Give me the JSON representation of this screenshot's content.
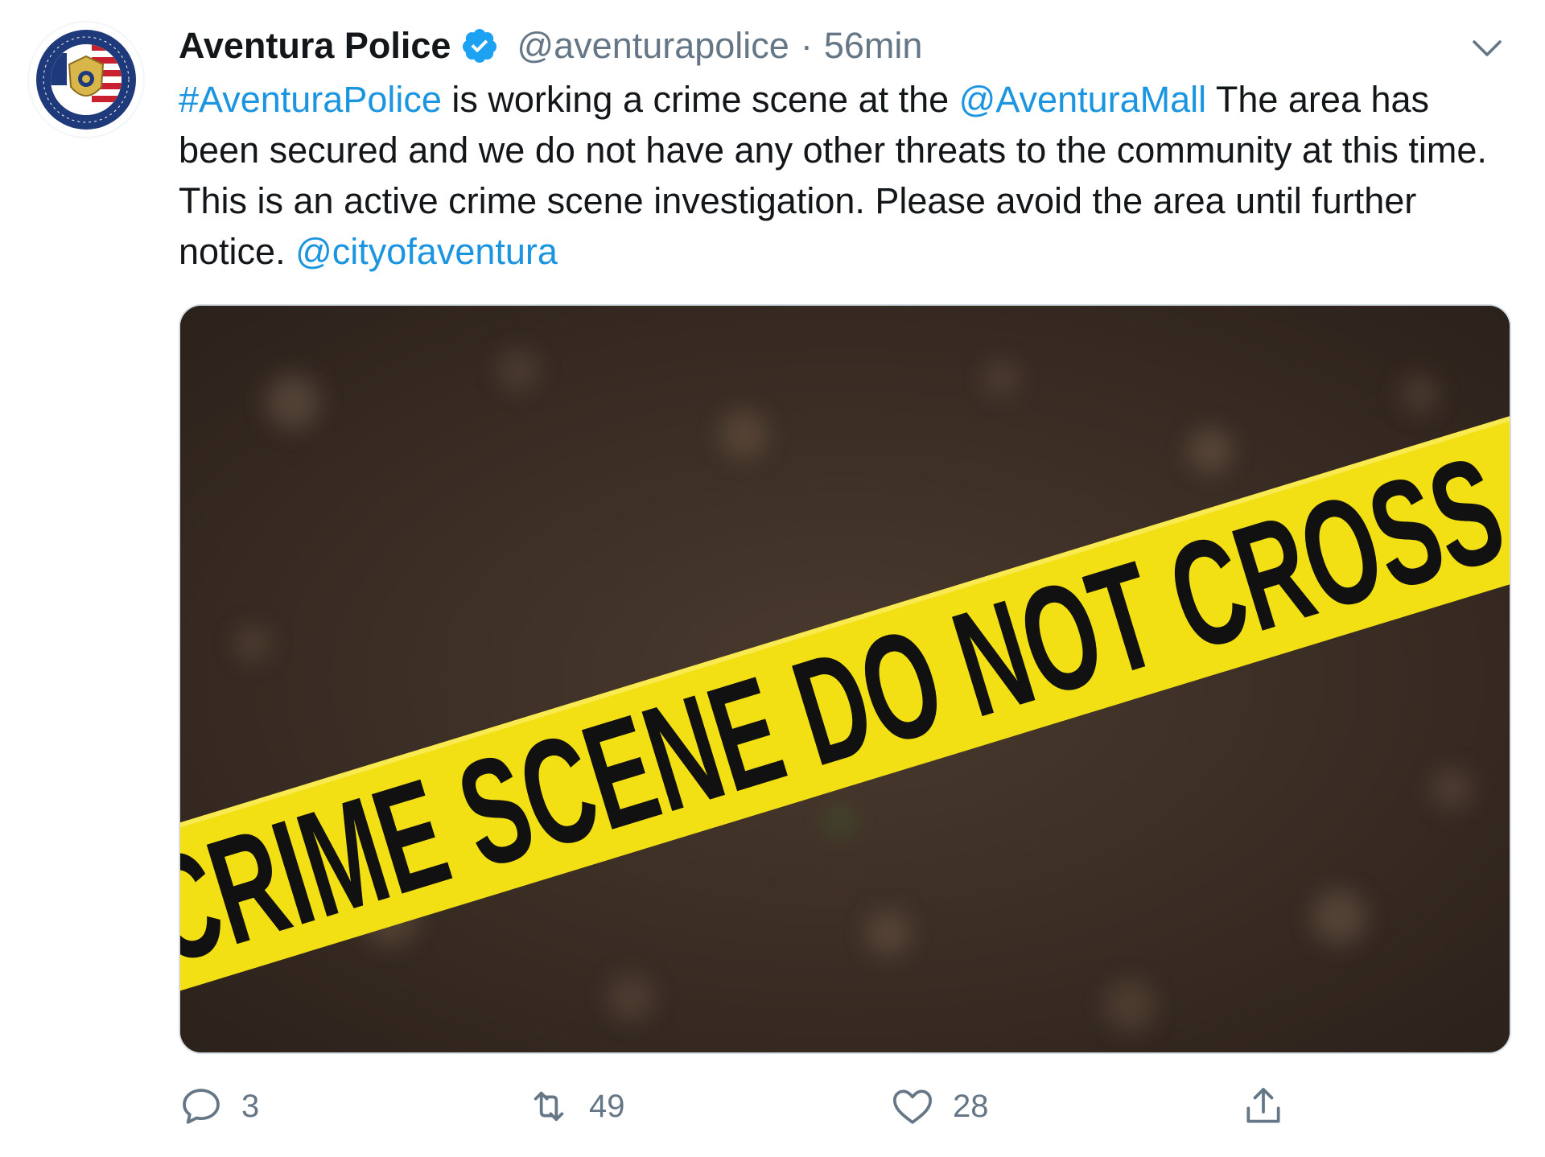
{
  "tweet": {
    "author": {
      "display_name": "Aventura Police",
      "handle": "@aventurapolice",
      "verified": true,
      "avatar_icon": "police-badge-seal-logo",
      "avatar_text": [
        "Aventura Police Department",
        "Florida"
      ]
    },
    "separator": "·",
    "time": "56min",
    "body": {
      "hashtag": "#AventuraPolice",
      "text_1": " is working a crime scene at the ",
      "mention_1": "@AventuraMall",
      "text_2": " The area has been secured and we do not have any other threats to the community at this time. This is an active crime scene investigation. Please avoid the area until further notice. ",
      "mention_2": "@cityofaventura"
    },
    "media": {
      "description_icon": "crime-scene-tape-photo",
      "tape_text": "CRIME SCENE DO NOT CROSS",
      "colors": {
        "tape": "#f2df14",
        "ground": "#3a2d24"
      }
    },
    "actions": {
      "reply": {
        "icon": "reply-icon",
        "count": "3"
      },
      "retweet": {
        "icon": "retweet-icon",
        "count": "49"
      },
      "like": {
        "icon": "heart-icon",
        "count": "28"
      },
      "share": {
        "icon": "share-icon"
      }
    },
    "menu_icon": "chevron-down-icon"
  },
  "colors": {
    "link": "#1b95e0",
    "secondary_text": "#657786",
    "primary_text": "#14171a",
    "verified": "#1da1f2"
  }
}
